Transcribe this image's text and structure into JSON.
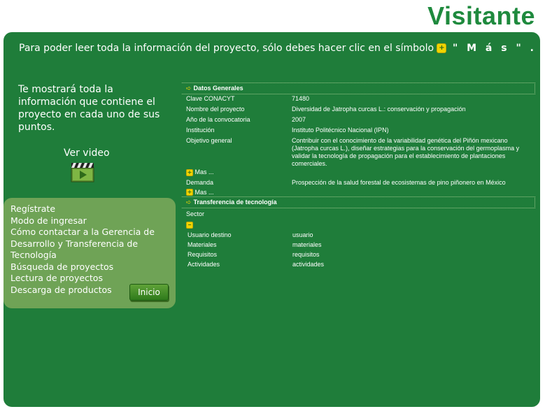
{
  "page_title": "Visitante",
  "instruction": {
    "text": "Para poder leer toda la información del proyecto, sólo debes hacer clic en el símbolo",
    "symbol": "+",
    "mas_text": "\" M á s \" ."
  },
  "intro": "Te mostrará toda la información que contiene el proyecto en cada uno de sus puntos.",
  "video": {
    "label": "Ver video",
    "icon": "clapperboard-icon"
  },
  "menu": {
    "items": [
      "Regístrate",
      "Modo de ingresar",
      "Cómo contactar a la Gerencia de Desarrollo y Transferencia de Tecnología",
      "Búsqueda de proyectos",
      "Lectura de proyectos",
      "Descarga de productos"
    ],
    "inicio_label": "Inicio"
  },
  "datos_generales": {
    "header": "Datos Generales",
    "rows": [
      {
        "key": "Clave CONACYT",
        "value": "71480"
      },
      {
        "key": "Nombre del proyecto",
        "value": "Diversidad de Jatropha curcas L.: conservación y propagación"
      },
      {
        "key": "Año de la convocatoria",
        "value": "2007"
      },
      {
        "key": "Institución",
        "value": "Instituto Politécnico Nacional (IPN)"
      },
      {
        "key": "Objetivo general",
        "value": "Contribuir con el conocimiento de la variabilidad genética del Piñón mexicano (Jatropha curcas L.), diseñar estrategias para la conservación del germoplasma y validar la tecnología de propagación para el establecimiento de plantaciones comerciales."
      }
    ],
    "mas_label": "Mas ...",
    "demanda_key": "Demanda",
    "demanda_value": "Prospección de la salud forestal de ecosistemas de pino piñonero en México",
    "mas_label_2": "Mas ..."
  },
  "transferencia": {
    "header": "Transferencia de tecnología",
    "sector_label": "Sector",
    "rows": [
      {
        "key": "Usuario destino",
        "value": "usuario"
      },
      {
        "key": "Materiales",
        "value": "materiales"
      },
      {
        "key": "Requisitos",
        "value": "requisitos"
      },
      {
        "key": "Actividades",
        "value": "actividades"
      }
    ]
  },
  "colors": {
    "panel": "#1f7d3a",
    "menu_box": "#6fa356",
    "title": "#1f8a3e",
    "badge": "#f0d400"
  }
}
